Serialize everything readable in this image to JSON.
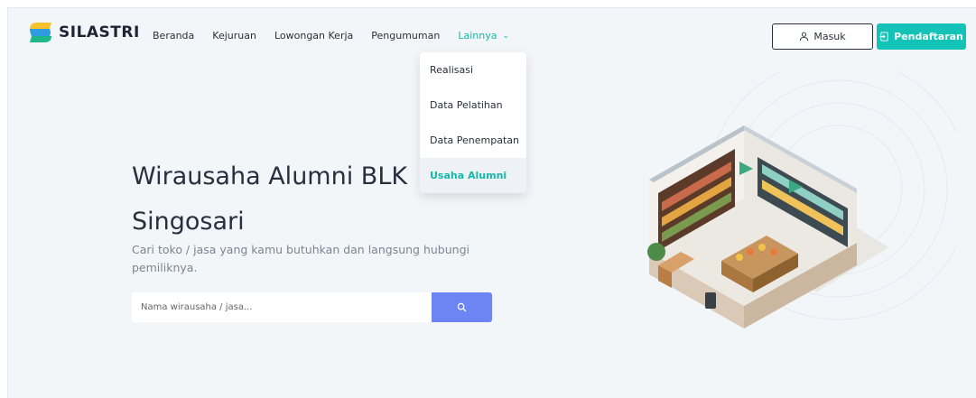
{
  "brand": {
    "name": "SILASTRI"
  },
  "nav": {
    "items": [
      {
        "label": "Beranda"
      },
      {
        "label": "Kejuruan"
      },
      {
        "label": "Lowongan Kerja"
      },
      {
        "label": "Pengumuman"
      }
    ],
    "active": {
      "label": "Lainnya",
      "icon": "chevron-down-icon"
    }
  },
  "auth": {
    "login_label": "Masuk",
    "register_label": "Pendaftaran"
  },
  "dropdown": {
    "items": [
      {
        "label": "Realisasi"
      },
      {
        "label": "Data Pelatihan"
      },
      {
        "label": "Data Penempatan"
      },
      {
        "label": "Usaha Alumni"
      }
    ]
  },
  "hero": {
    "title": "Wirausaha Alumni BLK Singosari",
    "subtitle": "Cari toko / jasa yang kamu butuhkan dan langsung hubungi pemiliknya."
  },
  "search": {
    "placeholder": "Nama wirausaha / jasa..."
  },
  "colors": {
    "accent": "#14c3b8",
    "search_button": "#6c85f3",
    "background": "#f3f6f9"
  }
}
